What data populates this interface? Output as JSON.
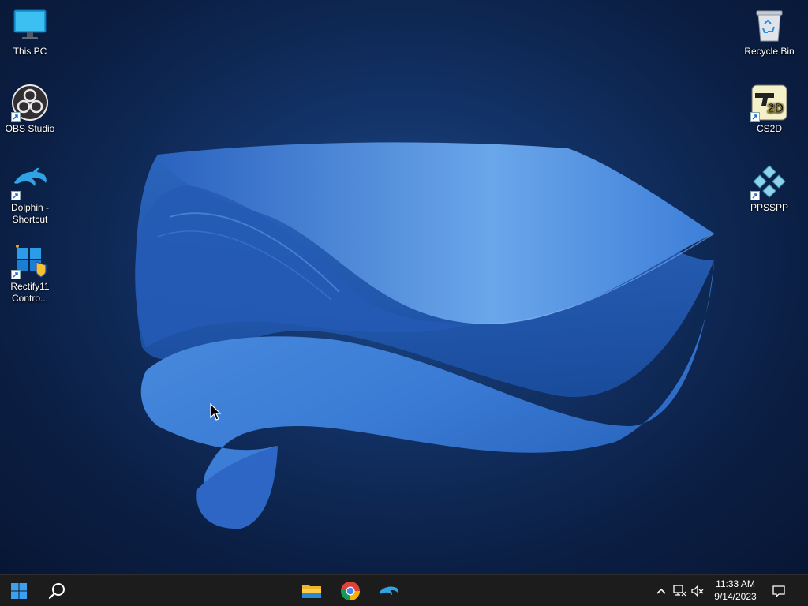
{
  "desktop": {
    "icons_left": [
      {
        "name": "this-pc",
        "label": "This PC",
        "icon": "monitor-icon"
      },
      {
        "name": "obs-studio",
        "label": "OBS Studio",
        "icon": "obs-icon"
      },
      {
        "name": "dolphin-shortcut",
        "label": "Dolphin - Shortcut",
        "icon": "dolphin-icon"
      },
      {
        "name": "rectify11",
        "label": "Rectify11 Contro...",
        "icon": "rectify11-icon"
      }
    ],
    "icons_right": [
      {
        "name": "recycle-bin",
        "label": "Recycle Bin",
        "icon": "recycle-bin-icon"
      },
      {
        "name": "cs2d",
        "label": "CS2D",
        "icon": "cs2d-icon"
      },
      {
        "name": "ppsspp",
        "label": "PPSSPP",
        "icon": "ppsspp-icon"
      }
    ]
  },
  "taskbar": {
    "start_icon": "windows-logo-icon",
    "search_icon": "search-icon",
    "pinned": [
      "file-explorer-icon",
      "chrome-icon",
      "dolphin-icon"
    ],
    "tray": {
      "chevron": "chevron-up-icon",
      "network": "network-icon",
      "volume": "volume-muted-icon",
      "time": "11:33 AM",
      "date": "9/14/2023",
      "notifications": "notification-icon"
    }
  },
  "colors": {
    "taskbar_bg": "#1c1c1c",
    "wallpaper_dark": "#081634",
    "wallpaper_bloom": "#3a7bd5"
  }
}
